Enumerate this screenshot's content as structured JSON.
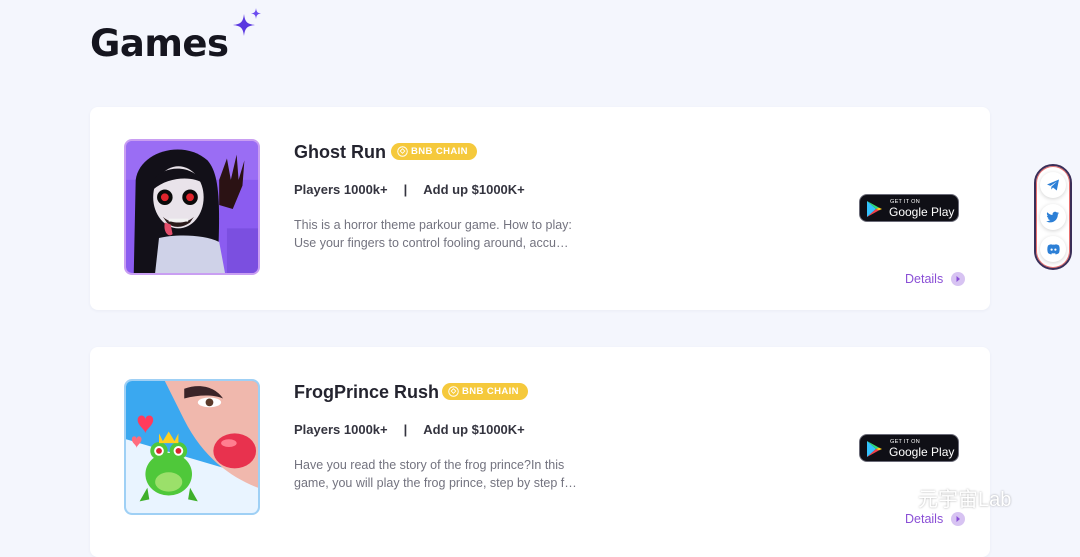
{
  "page": {
    "title": "Games"
  },
  "games": [
    {
      "title": "Ghost Run",
      "chain_badge": "BNB CHAIN",
      "players": "Players 1000k+",
      "separator": "|",
      "add_up": "Add up $1000K+",
      "description_lines": [
        "This is a horror theme parkour game. How to play:",
        "Use your fingers to control fooling around, accu…"
      ],
      "store_button": {
        "small": "GET IT ON",
        "big": "Google Play"
      },
      "details_label": "Details"
    },
    {
      "title": "FrogPrince Rush",
      "chain_badge": "BNB CHAIN",
      "players": "Players 1000k+",
      "separator": "|",
      "add_up": "Add up $1000K+",
      "description_lines": [
        "Have you read the story of the frog prince?In this",
        "game, you will play the frog prince, step by step f…"
      ],
      "store_button": {
        "small": "GET IT ON",
        "big": "Google Play"
      },
      "details_label": "Details"
    }
  ],
  "social": {
    "icons": [
      "telegram-icon",
      "twitter-icon",
      "discord-icon"
    ]
  },
  "watermark": {
    "text": "元宇宙Lab"
  },
  "colors": {
    "background": "#f4f6fd",
    "badge": "#f5c93c",
    "details": "#8a4fd6",
    "sparkle": "#5a38e0"
  }
}
